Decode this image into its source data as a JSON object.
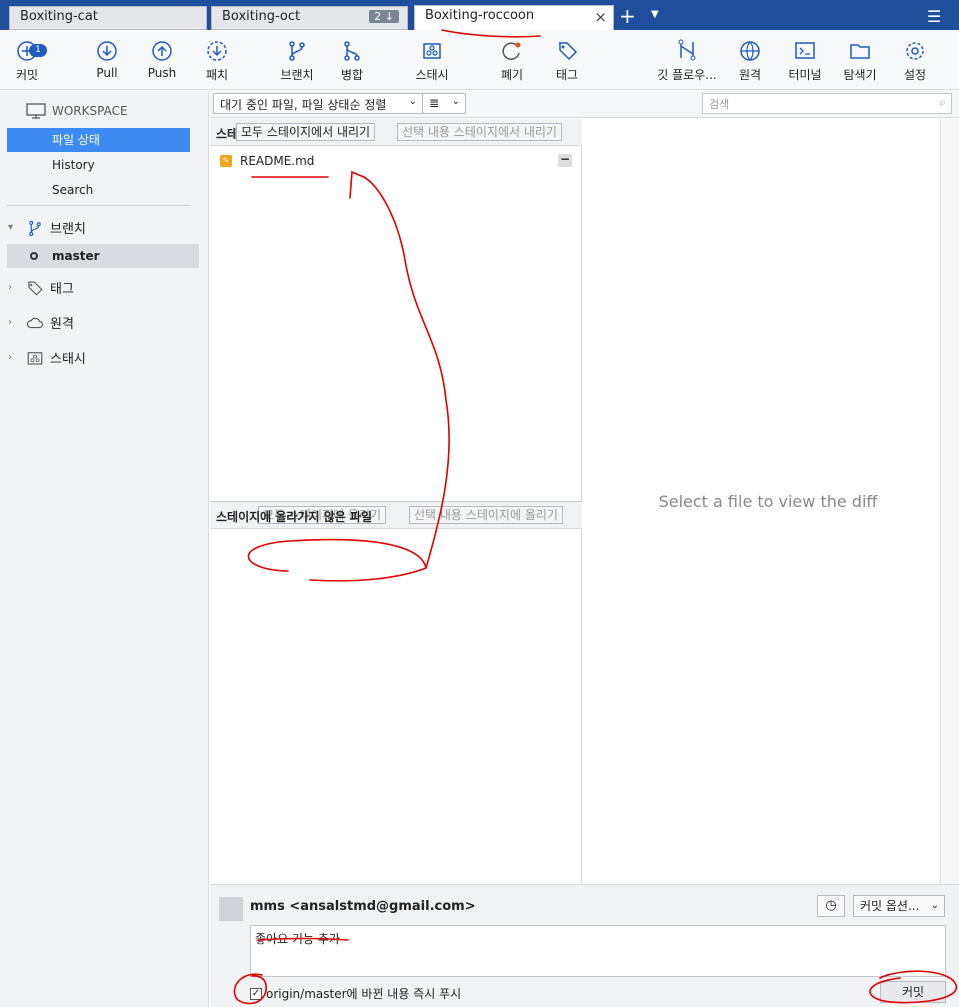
{
  "tabs": [
    {
      "label": "Boxiting-cat"
    },
    {
      "label": "Boxiting-oct",
      "badge": "2 ↓"
    },
    {
      "label": "Boxiting-roccoon",
      "active": true
    }
  ],
  "toolbar": {
    "commit": {
      "label": "커밋",
      "badge": "1"
    },
    "pull": {
      "label": "Pull"
    },
    "push": {
      "label": "Push"
    },
    "fetch": {
      "label": "패치"
    },
    "branch": {
      "label": "브랜치"
    },
    "merge": {
      "label": "병합"
    },
    "stash": {
      "label": "스태시"
    },
    "discard": {
      "label": "폐기"
    },
    "tag": {
      "label": "태그"
    },
    "gitflow": {
      "label": "깃 플로우..."
    },
    "remote": {
      "label": "원격"
    },
    "terminal": {
      "label": "터미널"
    },
    "explorer": {
      "label": "탐색기"
    },
    "settings": {
      "label": "설정"
    }
  },
  "sidebar": {
    "workspace": "WORKSPACE",
    "workspace_items": [
      "파일 상태",
      "History",
      "Search"
    ],
    "branches_label": "브랜치",
    "current_branch": "master",
    "tags_label": "태그",
    "remotes_label": "원격",
    "stashes_label": "스태시"
  },
  "filter": {
    "mode": "대기 중인 파일, 파일 상태순 정렬",
    "list_mode": "≣",
    "search_placeholder": "검색"
  },
  "staged": {
    "title": "스테",
    "unstage_all": "모두 스테이지에서 내리기",
    "unstage_selected": "선택 내용 스테이지에서 내리기",
    "files": [
      "README.md"
    ]
  },
  "unstaged": {
    "title": "스테이지에 올라가지 않은 파일",
    "stage_all": "모두 스테이지에 올리기",
    "stage_selected": "선택 내용 스테이지에 올리기"
  },
  "diff": {
    "empty_message": "Select a file to view the diff"
  },
  "commit": {
    "author": "mms <ansalstmd@gmail.com>",
    "options_label": "커밋 옵션...",
    "message": "좋아요 기능 추가",
    "push_label": "origin/master에 바뀐 내용 즉시 푸시",
    "push_checked": true,
    "commit_button": "커밋"
  },
  "colors": {
    "tabbar": "#1e4e9c",
    "accent": "#3d8af0",
    "annotation": "#e00000"
  }
}
